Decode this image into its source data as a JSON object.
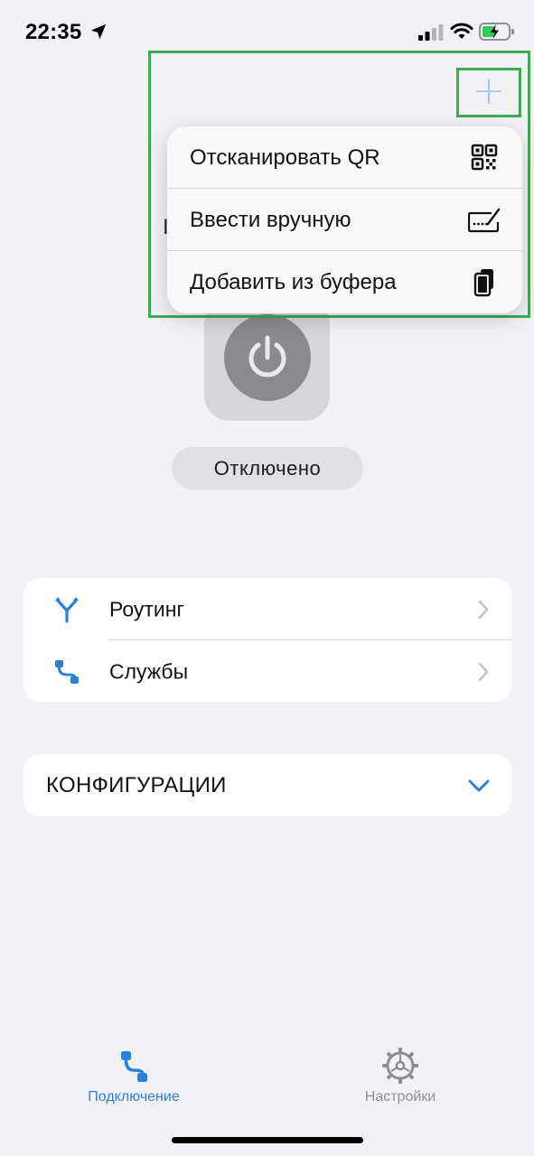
{
  "status_bar": {
    "time": "22:35",
    "location_icon": "location-arrow-icon",
    "signal_icon": "cellular-signal-icon",
    "wifi_icon": "wifi-icon",
    "battery_icon": "battery-charging-icon"
  },
  "header": {
    "add_icon": "plus-icon",
    "add_glyph": "+",
    "partial_text": "I"
  },
  "add_menu": {
    "items": [
      {
        "label": "Отсканировать QR",
        "icon": "qr-code-icon"
      },
      {
        "label": "Ввести вручную",
        "icon": "keyboard-edit-icon"
      },
      {
        "label": "Добавить из буфера",
        "icon": "clipboard-icon"
      }
    ]
  },
  "connection": {
    "power_icon": "power-icon",
    "status": "Отключено"
  },
  "settings_list": {
    "items": [
      {
        "label": "Роутинг",
        "icon": "routing-icon"
      },
      {
        "label": "Службы",
        "icon": "services-icon"
      }
    ]
  },
  "configurations": {
    "title": "КОНФИГУРАЦИИ",
    "icon": "chevron-down-icon"
  },
  "tab_bar": {
    "tabs": [
      {
        "label": "Подключение",
        "icon": "connection-icon",
        "active": true
      },
      {
        "label": "Настройки",
        "icon": "gear-icon",
        "active": false
      }
    ]
  },
  "colors": {
    "accent": "#2b7fd4",
    "highlight": "#3fab4f",
    "background": "#f2f2f6",
    "inactive": "#8e8e93"
  }
}
